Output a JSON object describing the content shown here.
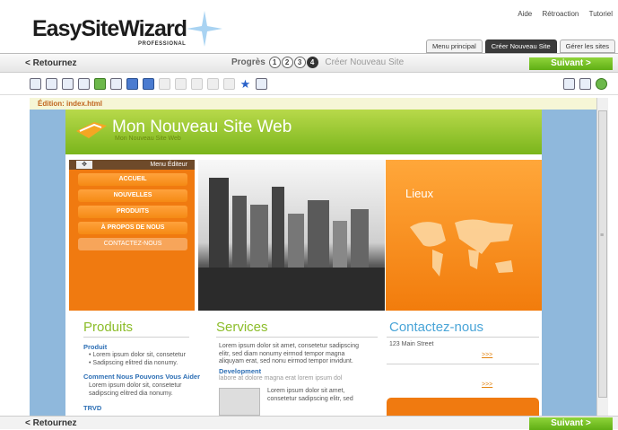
{
  "app": {
    "logo_text": "EasySiteWizard",
    "logo_sub": "PROFESSIONAL"
  },
  "top_links": [
    "Aide",
    "Rétroaction",
    "Tutoriel"
  ],
  "tabs": [
    {
      "label": "Menu principal",
      "active": false
    },
    {
      "label": "Créer Nouveau Site",
      "active": true
    },
    {
      "label": "Gérer les sites",
      "active": false
    }
  ],
  "nav": {
    "back_label": "< Retournez",
    "progress_label": "Progrès",
    "steps": [
      "1",
      "2",
      "3",
      "4"
    ],
    "current_step": "4",
    "progress_title": "Créer Nouveau Site",
    "next_label": "Suivant >"
  },
  "editor": {
    "label": "Édition: index.html"
  },
  "site": {
    "title": "Mon Nouveau Site Web",
    "subtitle": "Mon Nouveau Site Web",
    "menu_editor": "Menu Éditeur",
    "menu_items": [
      "ACCUEIL",
      "NOUVELLES",
      "PRODUITS",
      "À PROPOS DE NOUS",
      "CONTACTEZ-NOUS"
    ],
    "lieux": "Lieux",
    "produits": {
      "heading": "Produits",
      "link1": "Produit",
      "bullets": [
        "Lorem ipsum dolor sit, consetetur",
        "Sadipscing elitred dia nonumy."
      ],
      "link2": "Comment Nous Pouvons Vous Aider",
      "text": "Lorem ipsum dolor sit, consetetur sadipscing elitred dia nonumy.",
      "link3": "TRVD"
    },
    "services": {
      "heading": "Services",
      "text": "Lorem ipsum dolor sit amet, consetetur sadipscing elitr, sed diam nonumy eirmod tempor magna aliquyam erat, sed nonu eirmod tempor invidunt.",
      "link": "Development",
      "small": "labore at dolore magna erat lorem ipsum dol",
      "text2": "Lorem ipsum dolor sit amet, consetetur sadipscing elitr, sed"
    },
    "contact": {
      "heading": "Contactez-nous",
      "address": "123 Main Street",
      "more1": ">>>",
      "more2": ">>>"
    }
  },
  "colors": {
    "accent_green": "#7ab51c",
    "orange": "#f07a10",
    "editor_bg": "#8fb8dc"
  },
  "icons": [
    "save-icon",
    "new-page-icon",
    "text-icon",
    "table-icon",
    "image-icon",
    "media-icon",
    "link-icon",
    "unlink-icon",
    "font-icon",
    "list-icon",
    "form-icon",
    "spell-icon",
    "favorite-icon",
    "special-icon",
    "preview-icon",
    "print-icon",
    "help-icon"
  ]
}
